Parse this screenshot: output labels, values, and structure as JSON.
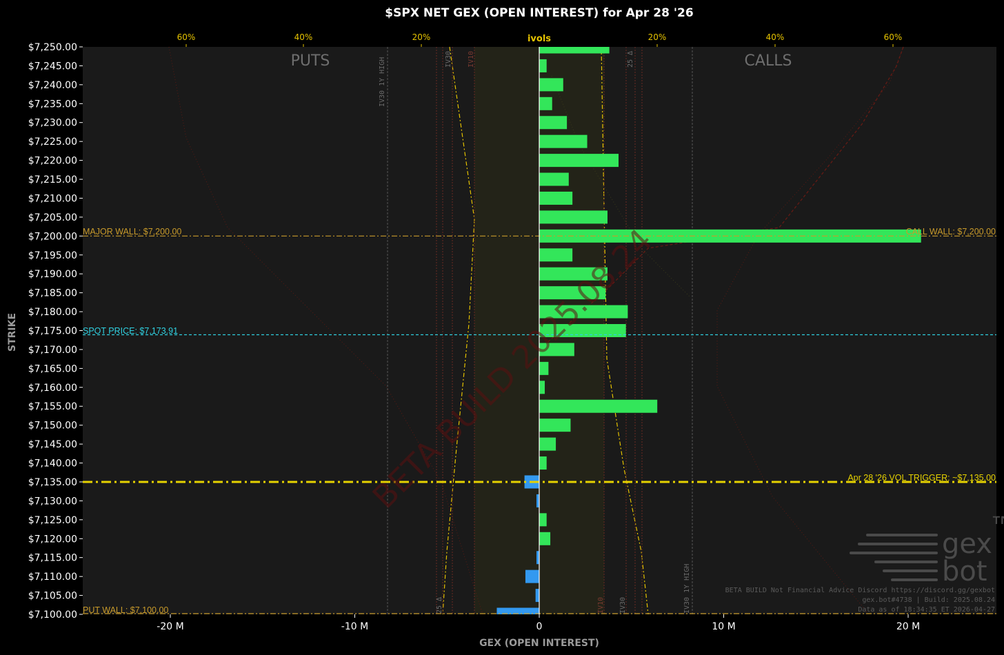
{
  "chart_data": {
    "type": "bar",
    "orientation": "horizontal",
    "title": "$SPX NET GEX (OPEN INTEREST) for Apr 28 '26",
    "xlabel": "GEX (OPEN INTEREST)",
    "ylabel": "STRIKE",
    "xlim": [
      -25,
      25
    ],
    "ylim": [
      7100,
      7250
    ],
    "x_ticks": [
      -20,
      -10,
      0,
      10,
      20
    ],
    "x_tick_labels": [
      "-20 M",
      "-10 M",
      "0",
      "10 M",
      "20 M"
    ],
    "strikes": [
      7250,
      7245,
      7240,
      7235,
      7230,
      7225,
      7220,
      7215,
      7210,
      7205,
      7200,
      7195,
      7190,
      7185,
      7180,
      7175,
      7170,
      7165,
      7160,
      7155,
      7150,
      7145,
      7140,
      7135,
      7130,
      7125,
      7120,
      7115,
      7110,
      7105,
      7100
    ],
    "strike_labels": [
      "$7,250.00",
      "$7,245.00",
      "$7,240.00",
      "$7,235.00",
      "$7,230.00",
      "$7,225.00",
      "$7,220.00",
      "$7,215.00",
      "$7,210.00",
      "$7,205.00",
      "$7,200.00",
      "$7,195.00",
      "$7,190.00",
      "$7,185.00",
      "$7,180.00",
      "$7,175.00",
      "$7,170.00",
      "$7,165.00",
      "$7,160.00",
      "$7,155.00",
      "$7,150.00",
      "$7,145.00",
      "$7,140.00",
      "$7,135.00",
      "$7,130.00",
      "$7,125.00",
      "$7,120.00",
      "$7,115.00",
      "$7,110.00",
      "$7,105.00",
      "$7,100.00"
    ],
    "values": [
      3.8,
      0.4,
      1.3,
      0.7,
      1.5,
      2.6,
      4.3,
      1.6,
      1.8,
      3.7,
      20.7,
      1.8,
      3.7,
      3.6,
      4.8,
      4.7,
      1.9,
      0.5,
      0.3,
      6.4,
      1.7,
      0.9,
      0.4,
      -0.8,
      -0.15,
      0.4,
      0.6,
      -0.15,
      -0.75,
      -0.2,
      -2.3
    ],
    "positive_color": "#33e65a",
    "negative_color": "#3399f0",
    "iv_axis": {
      "label": "ivols",
      "ticks": [
        "60%",
        "40%",
        "20%",
        "20%",
        "40%",
        "60%"
      ]
    },
    "side_labels": {
      "puts": "PUTS",
      "calls": "CALLS"
    },
    "levels": {
      "major_wall": {
        "label": "MAJOR WALL: $7,200.00",
        "strike": 7200,
        "color": "#c89a2a"
      },
      "call_wall": {
        "label": "CALL WALL: $7,200.00",
        "strike": 7200,
        "color": "#c89a2a"
      },
      "spot_price": {
        "label": "SPOT PRICE: $7,173.91",
        "strike": 7173.91,
        "color": "#2fd0e0"
      },
      "vol_trigger": {
        "label": "Apr 28 '26 VOL TRIGGER: ~$7,135.00",
        "strike": 7135,
        "color": "#e6d200"
      },
      "put_wall": {
        "label": "PUT WALL: $7,100.00",
        "strike": 7100,
        "color": "#c89a2a"
      }
    },
    "annotations": {
      "iv30_high_left": "IV30 1Y HIGH",
      "iv30_high_right": "IV30 1Y HIGH",
      "delta25_left": "25 Δ",
      "delta25_right": "25 Δ",
      "iv30_left": "IV30",
      "iv30_right": "IV30",
      "iv10_left": "IV10",
      "iv10_right": "IV10"
    },
    "watermark": "BETA BUILD 2025.08.24",
    "footer": [
      "BETA BUILD Not Financial Advice Discord https://discord.gg/gexbot",
      "gex.bot#4738 | Build: 2025.08.24",
      "Data as of 18:34:35 ET 2026-04-27"
    ],
    "logo": {
      "top": "gex",
      "bottom": "bot",
      "mark": "™"
    }
  }
}
